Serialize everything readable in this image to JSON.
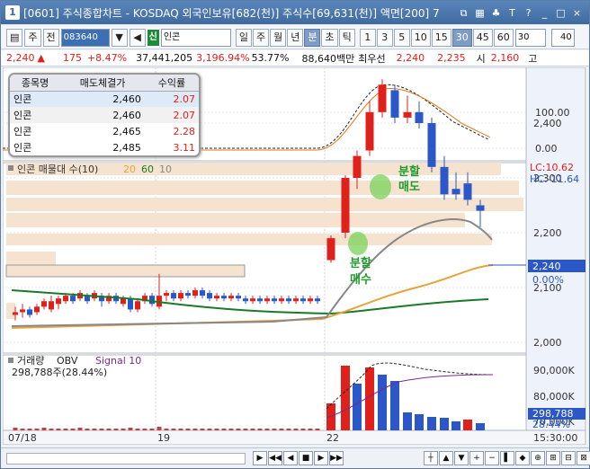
{
  "window": {
    "number": "1",
    "title": "[0601] 주식종합차트 - KOSDAQ 외국인보유[682(천)] 주식수[69,631(천)] 액면[200] 7",
    "title_icons": [
      "restore-icon",
      "grid-icon",
      "lock-icon",
      "font-icon",
      "help-icon",
      "minimize-icon",
      "maximize-icon",
      "close-icon"
    ],
    "title_glyphs": [
      "⧉",
      "▦",
      "♣",
      "T",
      "?",
      "_",
      "□",
      "×"
    ]
  },
  "toolbar": {
    "grid_glyph": "▤",
    "market_select": "주",
    "whole_label": "전",
    "stock_code": "083640",
    "dropdown_glyph": "▼",
    "speaker_glyph": "◀",
    "stock_type_badge": "신",
    "stock_name": "인콘",
    "period_buttons": [
      "일",
      "주",
      "월",
      "년",
      "분",
      "초",
      "틱"
    ],
    "period_selected": "분",
    "interval_buttons": [
      "1",
      "3",
      "5",
      "10",
      "15",
      "30",
      "45",
      "60"
    ],
    "interval_selected": "30",
    "interval_select_value": "30",
    "count_value": "40"
  },
  "quote": {
    "price": "2,240",
    "arrow": "▲",
    "change": "175",
    "change_pct": "+8.47%",
    "volume": "37,441,205",
    "volume_ratio": "3,196.94%",
    "turnover": "53.77%",
    "amount": "88,640백만",
    "best_label": "최우선",
    "best_ask": "2,240",
    "best_bid": "2,235",
    "open_label": "시",
    "open": "2,160",
    "high_label": "고"
  },
  "trade_table": {
    "headers": [
      "종목명",
      "매도체결가",
      "수익률"
    ],
    "rows": [
      {
        "name": "인콘",
        "price": "2,460",
        "ret": "2.07"
      },
      {
        "name": "인콘",
        "price": "2,460",
        "ret": "2.07"
      },
      {
        "name": "인콘",
        "price": "2,465",
        "ret": "2.28"
      },
      {
        "name": "인콘",
        "price": "2,485",
        "ret": "3.11"
      }
    ]
  },
  "indicator_axis": [
    "100.00",
    "0.00"
  ],
  "price_panel": {
    "legend_name": "인콘 매물대 수(10)",
    "ma_labels": [
      "20",
      "60",
      "10"
    ],
    "ma_colors": [
      "#e8a33a",
      "#1a7a2a",
      "#888888"
    ],
    "lc_label": "LC:10.62",
    "hc_label": "HC:-11.64",
    "axis": [
      "2,400",
      "2,300",
      "2,200",
      "2,100",
      "2,000"
    ],
    "current_price": "2,240",
    "current_pct": "0.00%",
    "sell_annotation": [
      "분할",
      "매도"
    ],
    "buy_annotation": [
      "분할",
      "매수"
    ]
  },
  "volume_panel": {
    "legend": [
      "거래량",
      "OBV",
      "Signal 10"
    ],
    "volume_text": "298,788주(28.44%)",
    "axis": [
      "90,000K",
      "80,000K",
      "70,000K"
    ],
    "current_volume": "298,788",
    "current_volume_pct": "28.44%"
  },
  "time_axis": [
    "07/18",
    "19",
    "22",
    "15:30:00"
  ],
  "bottom": {
    "nav_buttons": [
      "▶",
      "◀◀",
      "◀",
      "■",
      "▶",
      "▶▶"
    ],
    "right_buttons": [
      "┼",
      "▲",
      "▼",
      "+",
      "−",
      "▌",
      "◆",
      "⊕",
      "⊞",
      "⊟",
      "⊠",
      "▦"
    ]
  },
  "colors": {
    "up": "#e0201a",
    "down": "#2b57c8",
    "ma20": "#e8a33a",
    "ma60": "#1a7a2a",
    "ma10": "#888888",
    "volume_profile": "#f5e3cf",
    "annotation_green": "#1f9b2d"
  }
}
